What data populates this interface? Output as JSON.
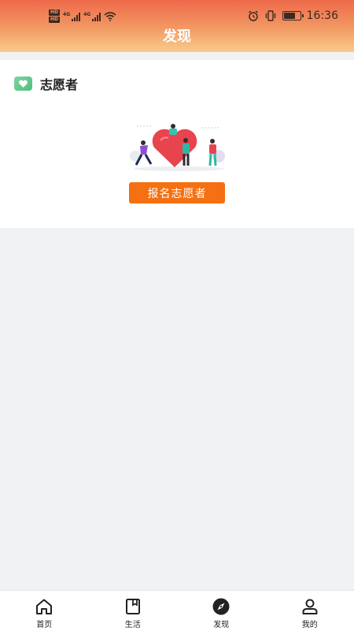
{
  "status_bar": {
    "hd1": "HD",
    "hd2": "HD",
    "net1": "4G",
    "net2": "4G",
    "battery_level": 0.75,
    "time": "16:36"
  },
  "header": {
    "title": "发现"
  },
  "volunteer": {
    "title": "志愿者",
    "button_label": "报名志愿者",
    "icon": "heart-icon"
  },
  "tabs": [
    {
      "label": "首页",
      "icon": "home-icon"
    },
    {
      "label": "生活",
      "icon": "book-icon"
    },
    {
      "label": "发现",
      "icon": "compass-icon",
      "active": true
    },
    {
      "label": "我的",
      "icon": "user-icon"
    }
  ],
  "colors": {
    "header_top": "#ee6a4a",
    "header_bottom": "#f7cd8c",
    "button": "#f57012",
    "badge": "#4fbf7a"
  }
}
